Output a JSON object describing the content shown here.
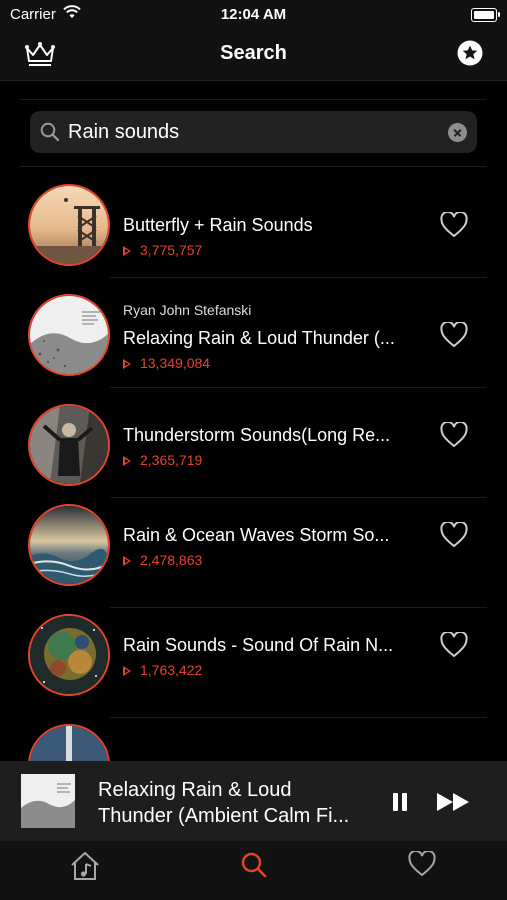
{
  "status": {
    "carrier": "Carrier",
    "time": "12:04 AM"
  },
  "nav": {
    "title": "Search",
    "left_icon": "crown-icon",
    "right_icon": "star-badge-icon"
  },
  "search": {
    "value": "Rain sounds",
    "placeholder": ""
  },
  "colors": {
    "accent": "#e2452a",
    "background": "#000000",
    "bar": "#121212"
  },
  "results": [
    {
      "artist": "",
      "title": "Butterfly + Rain Sounds",
      "plays": "3,775,757"
    },
    {
      "artist": "Ryan John Stefanski",
      "title": "Relaxing Rain & Loud Thunder (...",
      "plays": "13,349,084"
    },
    {
      "artist": "",
      "title": "Thunderstorm Sounds(Long Re...",
      "plays": "2,365,719"
    },
    {
      "artist": "",
      "title": "Rain & Ocean Waves Storm So...",
      "plays": "2,478,863"
    },
    {
      "artist": "",
      "title": "Rain Sounds - Sound Of Rain N...",
      "plays": "1,763,422"
    }
  ],
  "player": {
    "title": "Relaxing Rain & Loud Thunder (Ambient Calm Fi..."
  },
  "tabs": [
    {
      "icon": "home-music-icon",
      "active": false
    },
    {
      "icon": "search-icon",
      "active": true
    },
    {
      "icon": "heart-icon",
      "active": false
    }
  ]
}
